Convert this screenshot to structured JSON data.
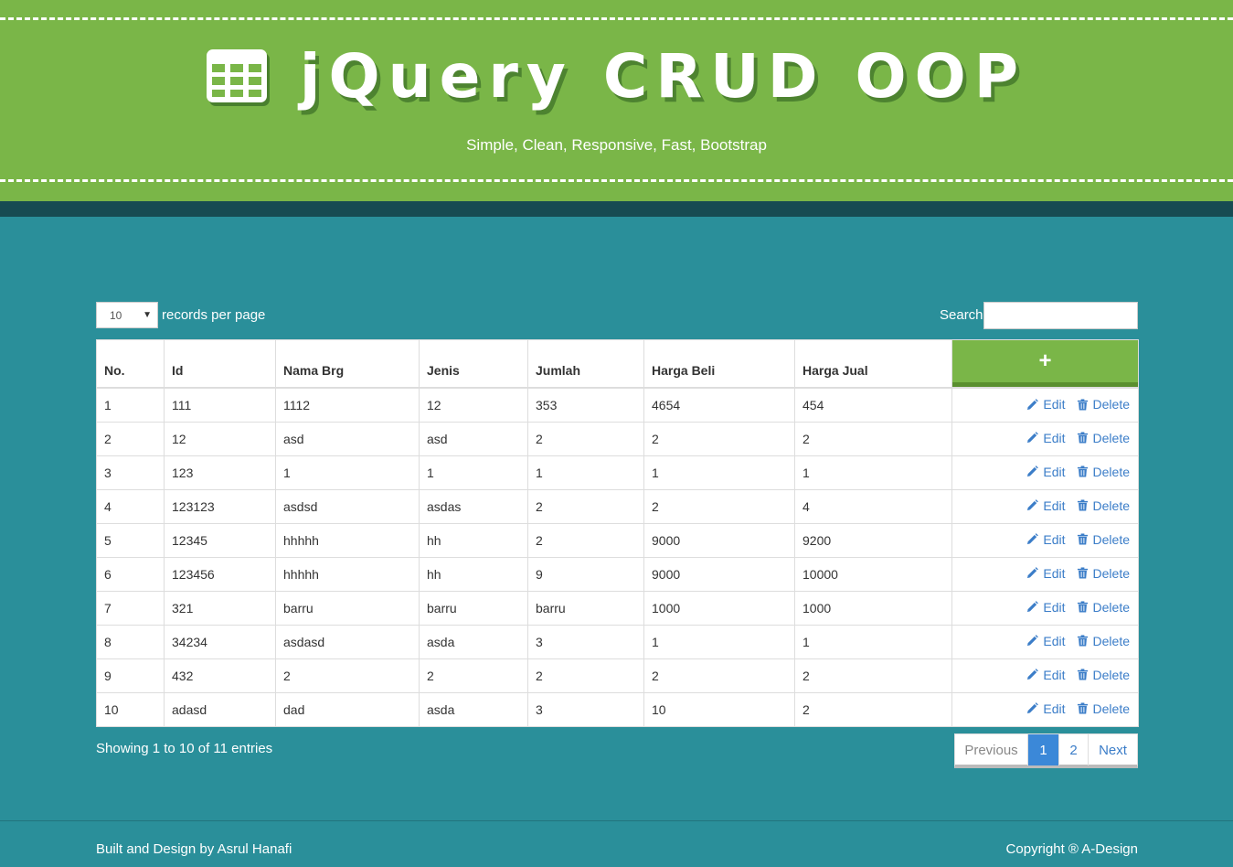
{
  "header": {
    "title": "jQuery CRUD OOP",
    "subtitle": "Simple, Clean, Responsive, Fast, Bootstrap",
    "icon": "table-icon"
  },
  "controls": {
    "length_value": "10",
    "length_label": "records per page",
    "search_label": "Search:",
    "search_value": ""
  },
  "table": {
    "columns": [
      "No.",
      "Id",
      "Nama Brg",
      "Jenis",
      "Jumlah",
      "Harga Beli",
      "Harga Jual"
    ],
    "add_label": "+",
    "edit_label": "Edit",
    "delete_label": "Delete",
    "rows": [
      [
        "1",
        "111",
        "1112",
        "12",
        "353",
        "4654",
        "454"
      ],
      [
        "2",
        "12",
        "asd",
        "asd",
        "2",
        "2",
        "2"
      ],
      [
        "3",
        "123",
        "1",
        "1",
        "1",
        "1",
        "1"
      ],
      [
        "4",
        "123123",
        "asdsd",
        "asdas",
        "2",
        "2",
        "4"
      ],
      [
        "5",
        "12345",
        "hhhhh",
        "hh",
        "2",
        "9000",
        "9200"
      ],
      [
        "6",
        "123456",
        "hhhhh",
        "hh",
        "9",
        "9000",
        "10000"
      ],
      [
        "7",
        "321",
        "barru",
        "barru",
        "barru",
        "1000",
        "1000"
      ],
      [
        "8",
        "34234",
        "asdasd",
        "asda",
        "3",
        "1",
        "1"
      ],
      [
        "9",
        "432",
        "2",
        "2",
        "2",
        "2",
        "2"
      ],
      [
        "10",
        "adasd",
        "dad",
        "asda",
        "3",
        "10",
        "2"
      ]
    ]
  },
  "info": "Showing 1 to 10 of 11 entries",
  "pagination": {
    "previous": "Previous",
    "pages": [
      "1",
      "2"
    ],
    "active_page": "1",
    "next": "Next"
  },
  "footer": {
    "left": "Built and Design by Asrul Hanafi",
    "right": "Copyright ® A-Design"
  },
  "colors": {
    "header_green": "#7ab648",
    "page_teal": "#2a8f9a",
    "band_dark": "#174b52",
    "link_blue": "#3b7dc8",
    "active_page_blue": "#3b88d8"
  }
}
